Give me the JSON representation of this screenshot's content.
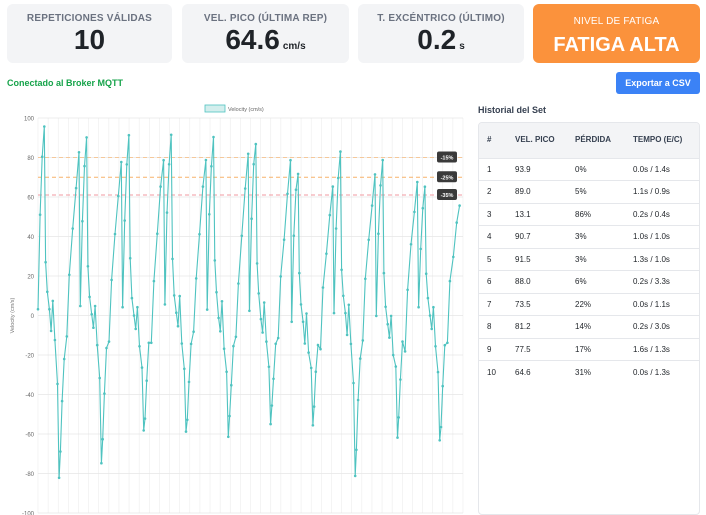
{
  "cards": [
    {
      "label": "REPETICIONES VÁLIDAS",
      "value": "10",
      "unit": ""
    },
    {
      "label": "VEL. PICO (ÚLTIMA REP)",
      "value": "64.6",
      "unit": "cm/s"
    },
    {
      "label": "T. EXCÉNTRICO (ÚLTIMO)",
      "value": "0.2",
      "unit": "s"
    }
  ],
  "fatigue": {
    "label": "NIVEL DE FATIGA",
    "value": "FATIGA ALTA",
    "color": "#fb923c"
  },
  "connection_status": "Conectado al Broker MQTT",
  "export_label": "Exportar a CSV",
  "history": {
    "title": "Historial del Set",
    "columns": [
      "#",
      "VEL. PICO",
      "PÉRDIDA",
      "TEMPO (E/C)"
    ],
    "rows": [
      [
        "1",
        "93.9",
        "0%",
        "0.0s / 1.4s"
      ],
      [
        "2",
        "89.0",
        "5%",
        "1.1s / 0.9s"
      ],
      [
        "3",
        "13.1",
        "86%",
        "0.2s / 0.4s"
      ],
      [
        "4",
        "90.7",
        "3%",
        "1.0s / 1.0s"
      ],
      [
        "5",
        "91.5",
        "3%",
        "1.3s / 1.0s"
      ],
      [
        "6",
        "88.0",
        "6%",
        "0.2s / 3.3s"
      ],
      [
        "7",
        "73.5",
        "22%",
        "0.0s / 1.1s"
      ],
      [
        "8",
        "81.2",
        "14%",
        "0.2s / 3.0s"
      ],
      [
        "9",
        "77.5",
        "17%",
        "1.6s / 1.3s"
      ],
      [
        "10",
        "64.6",
        "31%",
        "0.0s / 1.3s"
      ]
    ]
  },
  "chart_data": {
    "type": "line",
    "legend": "Velocity (cm/s)",
    "legend_position": "top-center",
    "ylabel": "Velocity (cm/s)",
    "ylim": [
      -100,
      100
    ],
    "yticks": [
      100,
      80,
      60,
      40,
      20,
      0,
      -20,
      -40,
      -60,
      -80,
      -100
    ],
    "grid": true,
    "line_color": "#4fc3c0",
    "thresholds": [
      {
        "label": "-15%",
        "value": 80,
        "color": "#f5c89a"
      },
      {
        "label": "-25%",
        "value": 70,
        "color": "#f7b26a"
      },
      {
        "label": "-35%",
        "value": 61,
        "color": "#f29aa0"
      }
    ],
    "reps": [
      {
        "peak": 93.9,
        "trough": -81,
        "plateau": 2
      },
      {
        "peak": 89.0,
        "trough": -73,
        "plateau": 0
      },
      {
        "peak": 90.7,
        "trough": -60,
        "plateau": 0
      },
      {
        "peak": 91.5,
        "trough": -60,
        "plateau": 2
      },
      {
        "peak": 91.0,
        "trough": -62,
        "plateau": 0
      },
      {
        "peak": 88.0,
        "trough": -55,
        "plateau": 0
      },
      {
        "peak": 73.5,
        "trough": -55,
        "plateau": -5
      },
      {
        "peak": 81.2,
        "trough": -80,
        "plateau": 0
      },
      {
        "peak": 77.5,
        "trough": -60,
        "plateau": -5
      },
      {
        "peak": 64.6,
        "trough": -65,
        "plateau": 0
      }
    ]
  }
}
